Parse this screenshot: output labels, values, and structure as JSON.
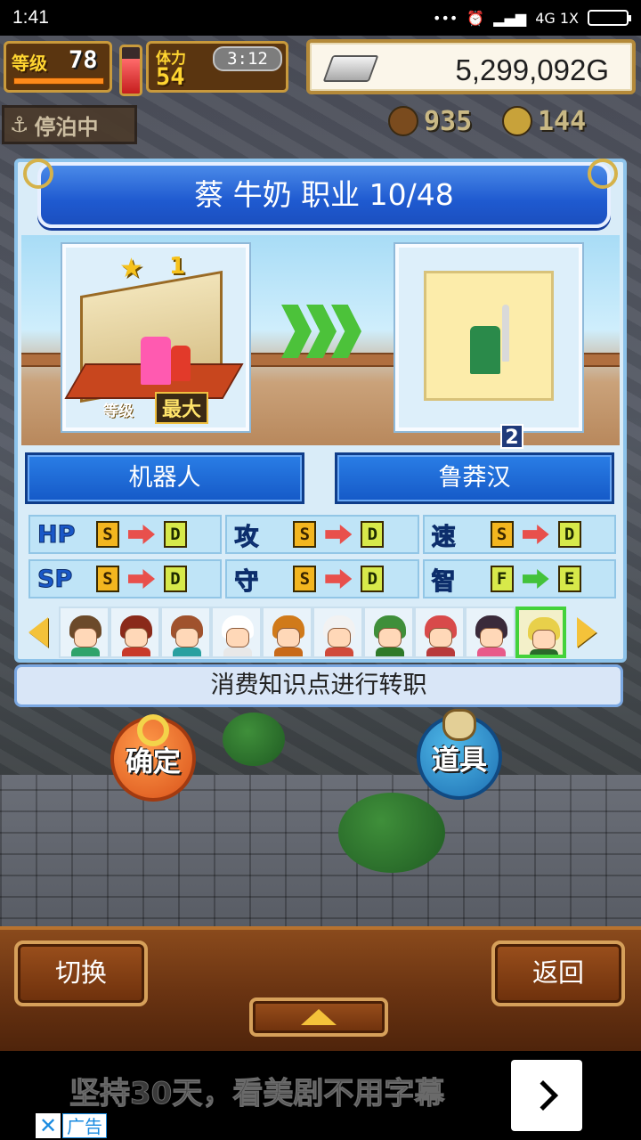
{
  "status_bar": {
    "time": "1:41",
    "network_label": "4G 1X"
  },
  "hud": {
    "level_label": "等级",
    "level_value": "78",
    "stamina_label": "体力",
    "stamina_value": "54",
    "stamina_fill_percent": 75,
    "clock": "3:12",
    "money": "5,299,092G",
    "moored_label": "停泊中",
    "resource_1": "935",
    "resource_2": "144"
  },
  "dialog": {
    "title": "蔡 牛奶  职业 10/48",
    "left_card": {
      "rank_number": "1",
      "level_tag": "等级",
      "max_tag": "最大"
    },
    "right_card": {
      "badge": "2"
    },
    "current_job": "机器人",
    "new_job": "鲁莽汉",
    "stats": [
      {
        "name": "HP",
        "from": "S",
        "to": "D",
        "direction": "down"
      },
      {
        "name": "攻",
        "from": "S",
        "to": "D",
        "direction": "down"
      },
      {
        "name": "速",
        "from": "S",
        "to": "D",
        "direction": "down"
      },
      {
        "name": "SP",
        "from": "S",
        "to": "D",
        "direction": "down"
      },
      {
        "name": "守",
        "from": "S",
        "to": "D",
        "direction": "down"
      },
      {
        "name": "智",
        "from": "F",
        "to": "E",
        "direction": "up"
      }
    ],
    "knowledge_prompt": "消费知识点进行转职"
  },
  "characters": [
    {
      "hair": "#6c4a2a",
      "body": "#2fa36b",
      "selected": false
    },
    {
      "hair": "#8a2a1a",
      "body": "#c83a2a",
      "selected": false
    },
    {
      "hair": "#a0522d",
      "body": "#2aa0a0",
      "selected": false
    },
    {
      "hair": "#ffffff",
      "body": "#e8e8e8",
      "selected": false
    },
    {
      "hair": "#d07a1a",
      "body": "#c86a1a",
      "selected": false
    },
    {
      "hair": "#f2f2f2",
      "body": "#d04a3a",
      "selected": false
    },
    {
      "hair": "#3f8f3a",
      "body": "#2f7a2a",
      "selected": false
    },
    {
      "hair": "#d84a4a",
      "body": "#b83a3a",
      "selected": false
    },
    {
      "hair": "#3a2a3a",
      "body": "#e85a8a",
      "selected": false
    },
    {
      "hair": "#e8d04a",
      "body": "#2a6a2a",
      "selected": true
    }
  ],
  "actions": {
    "confirm_label": "确定",
    "items_label": "道具"
  },
  "bottom_bar": {
    "switch_label": "切换",
    "back_label": "返回"
  },
  "ad": {
    "text": "坚持30天，看美剧不用字幕",
    "tag": "广告",
    "close_symbol": "✕"
  }
}
